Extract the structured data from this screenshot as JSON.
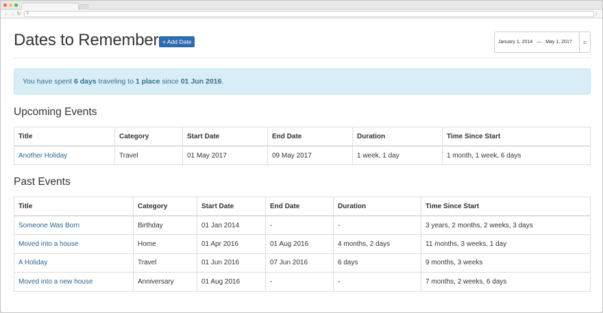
{
  "colors": {
    "primary": "#2f6db3",
    "link": "#2a6496",
    "alert_bg": "#d9edf7",
    "alert_text": "#31708f"
  },
  "browser": {
    "close_color": "#fc605c",
    "minimize_color": "#fdbc40",
    "maximize_color": "#34c84a"
  },
  "header": {
    "title": "Dates to Remember",
    "add_button": "+ Add Date",
    "date_start": "January 1, 2014",
    "date_sep": "—",
    "date_end": "May 1, 2017"
  },
  "alert": {
    "prefix": "You have spent ",
    "days": "6 days",
    "middle": " traveling to ",
    "places": "1 place",
    "since": " since ",
    "date": "01 Jun 2016",
    "suffix": "."
  },
  "upcoming": {
    "title": "Upcoming Events",
    "columns": [
      "Title",
      "Category",
      "Start Date",
      "End Date",
      "Duration",
      "Time Since Start"
    ],
    "rows": [
      [
        "Another Holiday",
        "Travel",
        "01 May 2017",
        "09 May 2017",
        "1 week, 1 day",
        "1 month, 1 week, 6 days"
      ]
    ]
  },
  "past": {
    "title": "Past Events",
    "columns": [
      "Title",
      "Category",
      "Start Date",
      "End Date",
      "Duration",
      "Time Since Start"
    ],
    "rows": [
      [
        "Someone Was Born",
        "Birthday",
        "01 Jan 2014",
        "-",
        "-",
        "3 years, 2 months, 2 weeks, 3 days"
      ],
      [
        "Moved into a house",
        "Home",
        "01 Apr 2016",
        "01 Aug 2016",
        "4 months, 2 days",
        "11 months, 3 weeks, 1 day"
      ],
      [
        "A Holiday",
        "Travel",
        "01 Jun 2016",
        "07 Jun 2016",
        "6 days",
        "9 months, 3 weeks"
      ],
      [
        "Moved into a new house",
        "Anniversary",
        "01 Aug 2016",
        "-",
        "-",
        "7 months, 2 weeks, 6 days"
      ]
    ]
  }
}
